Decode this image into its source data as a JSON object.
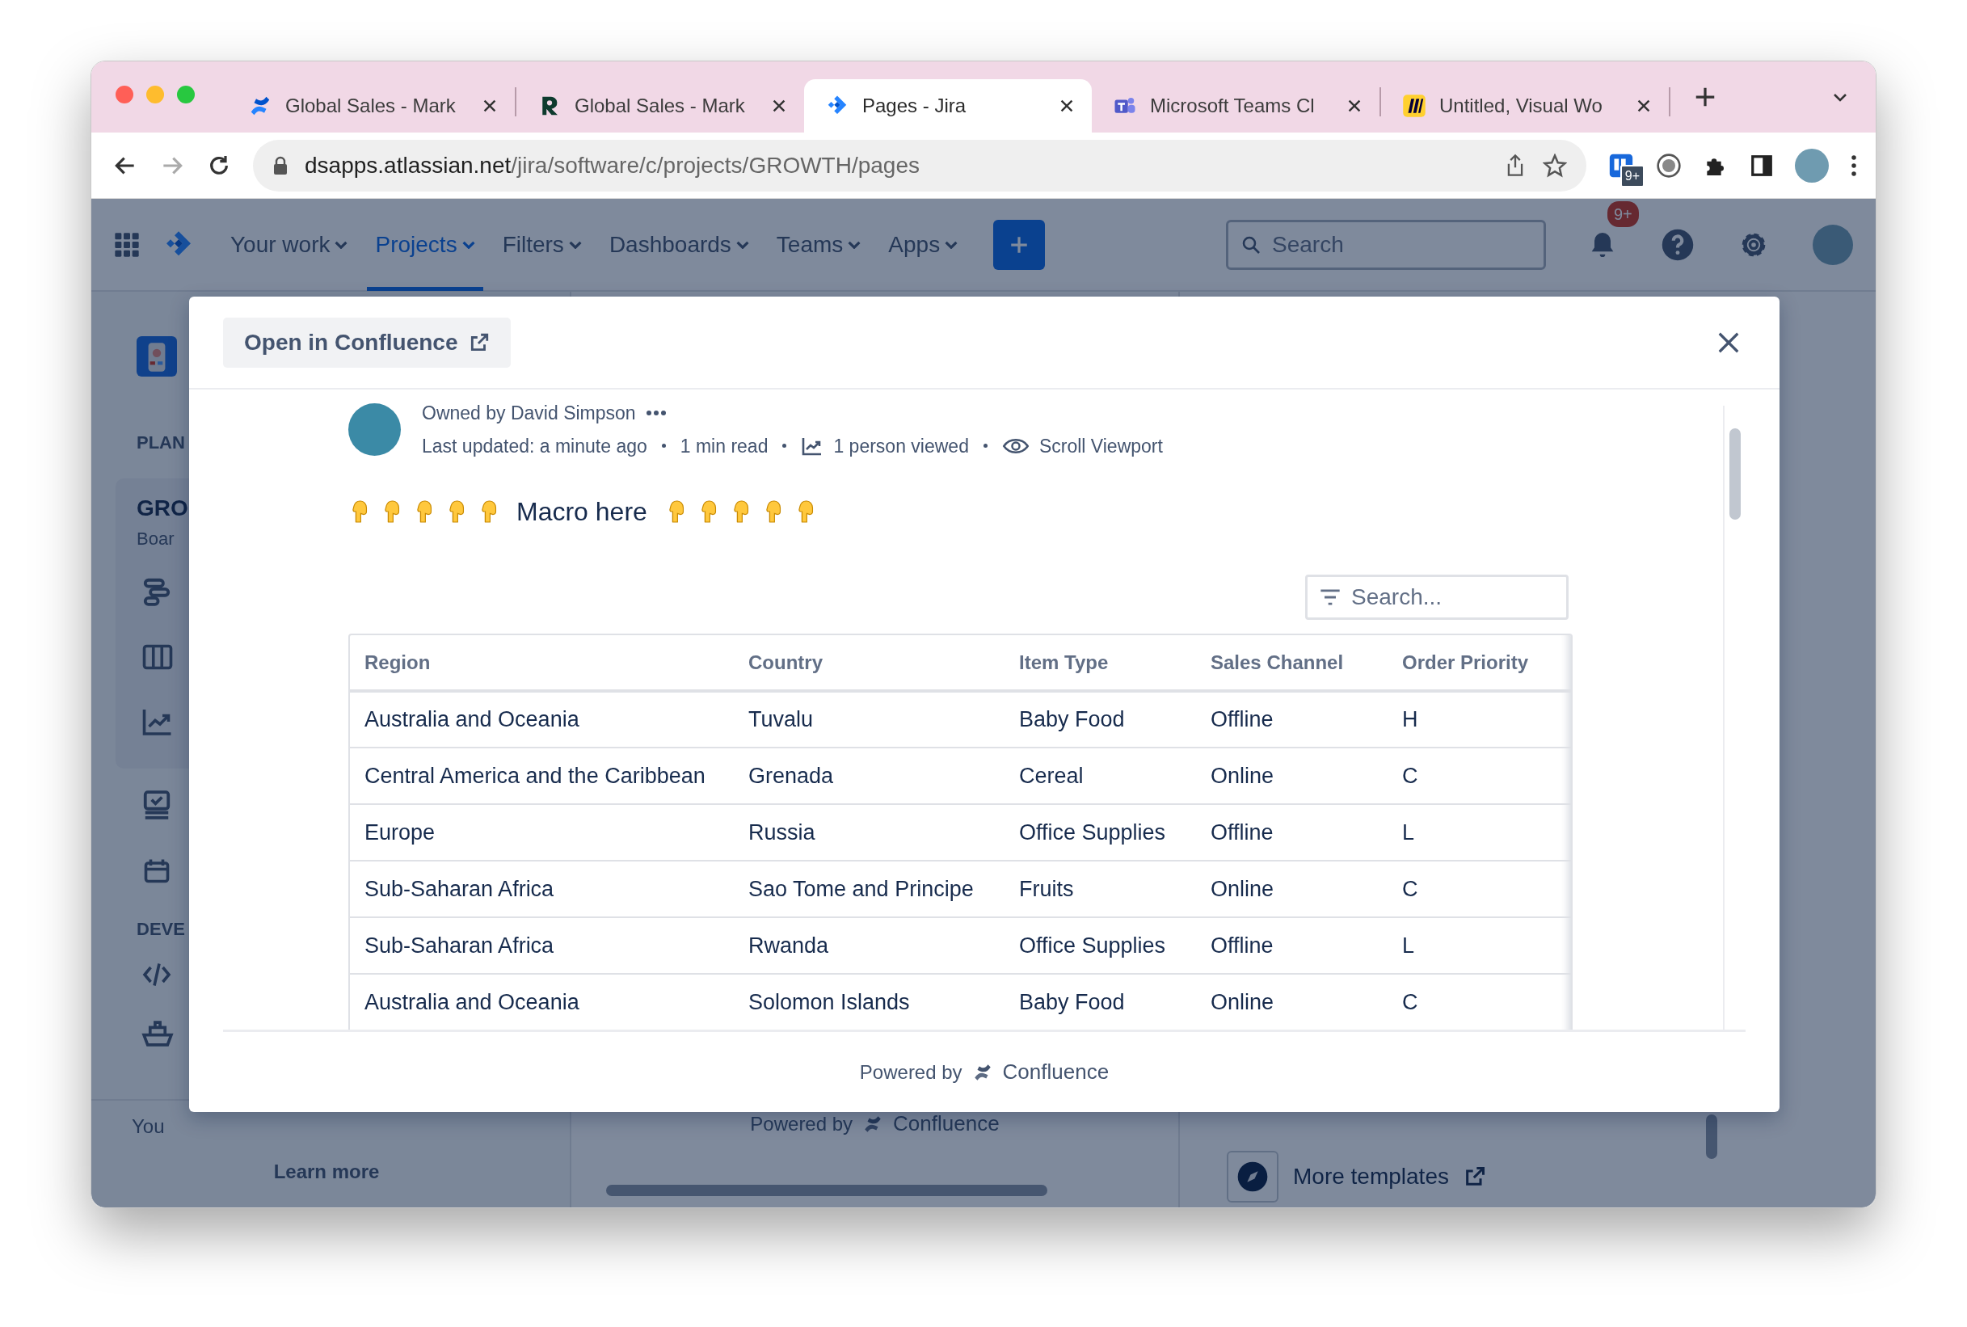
{
  "browser": {
    "tabs": [
      {
        "title": "Global Sales - Mark",
        "selected": false
      },
      {
        "title": "Global Sales - Mark",
        "selected": false
      },
      {
        "title": "Pages - Jira",
        "selected": true
      },
      {
        "title": "Microsoft Teams Cl",
        "selected": false
      },
      {
        "title": "Untitled, Visual Wo",
        "selected": false
      }
    ],
    "url": {
      "host": "dsapps.atlassian.net",
      "path": "/jira/software/c/projects/GROWTH/pages"
    },
    "extension_badge": "9+"
  },
  "nav": {
    "items": [
      {
        "label": "Your work",
        "selected": false
      },
      {
        "label": "Projects",
        "selected": true
      },
      {
        "label": "Filters",
        "selected": false
      },
      {
        "label": "Dashboards",
        "selected": false
      },
      {
        "label": "Teams",
        "selected": false
      },
      {
        "label": "Apps",
        "selected": false
      }
    ],
    "search": {
      "placeholder": "Search"
    },
    "notification_badge": "9+"
  },
  "sidebar": {
    "plan_heading": "PLAN",
    "project_name": "GRO",
    "project_subtitle": "Boar",
    "dev_heading": "DEVE",
    "footer_text": "You",
    "footer_link": "Learn more"
  },
  "background_page": {
    "powered_by": "Powered by",
    "brand": "Confluence",
    "more_templates": "More templates"
  },
  "modal": {
    "open_button": "Open in Confluence",
    "owner": "Owned by David Simpson",
    "meta": [
      "Last updated: a minute ago",
      "1 min read",
      "1 person viewed",
      "Scroll Viewport"
    ],
    "macro_text": "Macro here",
    "table_search": {
      "placeholder": "Search..."
    },
    "table": {
      "columns": [
        "Region",
        "Country",
        "Item Type",
        "Sales Channel",
        "Order Priority"
      ],
      "rows": [
        [
          "Australia and Oceania",
          "Tuvalu",
          "Baby Food",
          "Offline",
          "H"
        ],
        [
          "Central America and the Caribbean",
          "Grenada",
          "Cereal",
          "Online",
          "C"
        ],
        [
          "Europe",
          "Russia",
          "Office Supplies",
          "Offline",
          "L"
        ],
        [
          "Sub-Saharan Africa",
          "Sao Tome and Principe",
          "Fruits",
          "Online",
          "C"
        ],
        [
          "Sub-Saharan Africa",
          "Rwanda",
          "Office Supplies",
          "Offline",
          "L"
        ],
        [
          "Australia and Oceania",
          "Solomon Islands",
          "Baby Food",
          "Online",
          "C"
        ]
      ]
    },
    "footer": {
      "powered_by": "Powered by",
      "brand": "Confluence"
    }
  }
}
